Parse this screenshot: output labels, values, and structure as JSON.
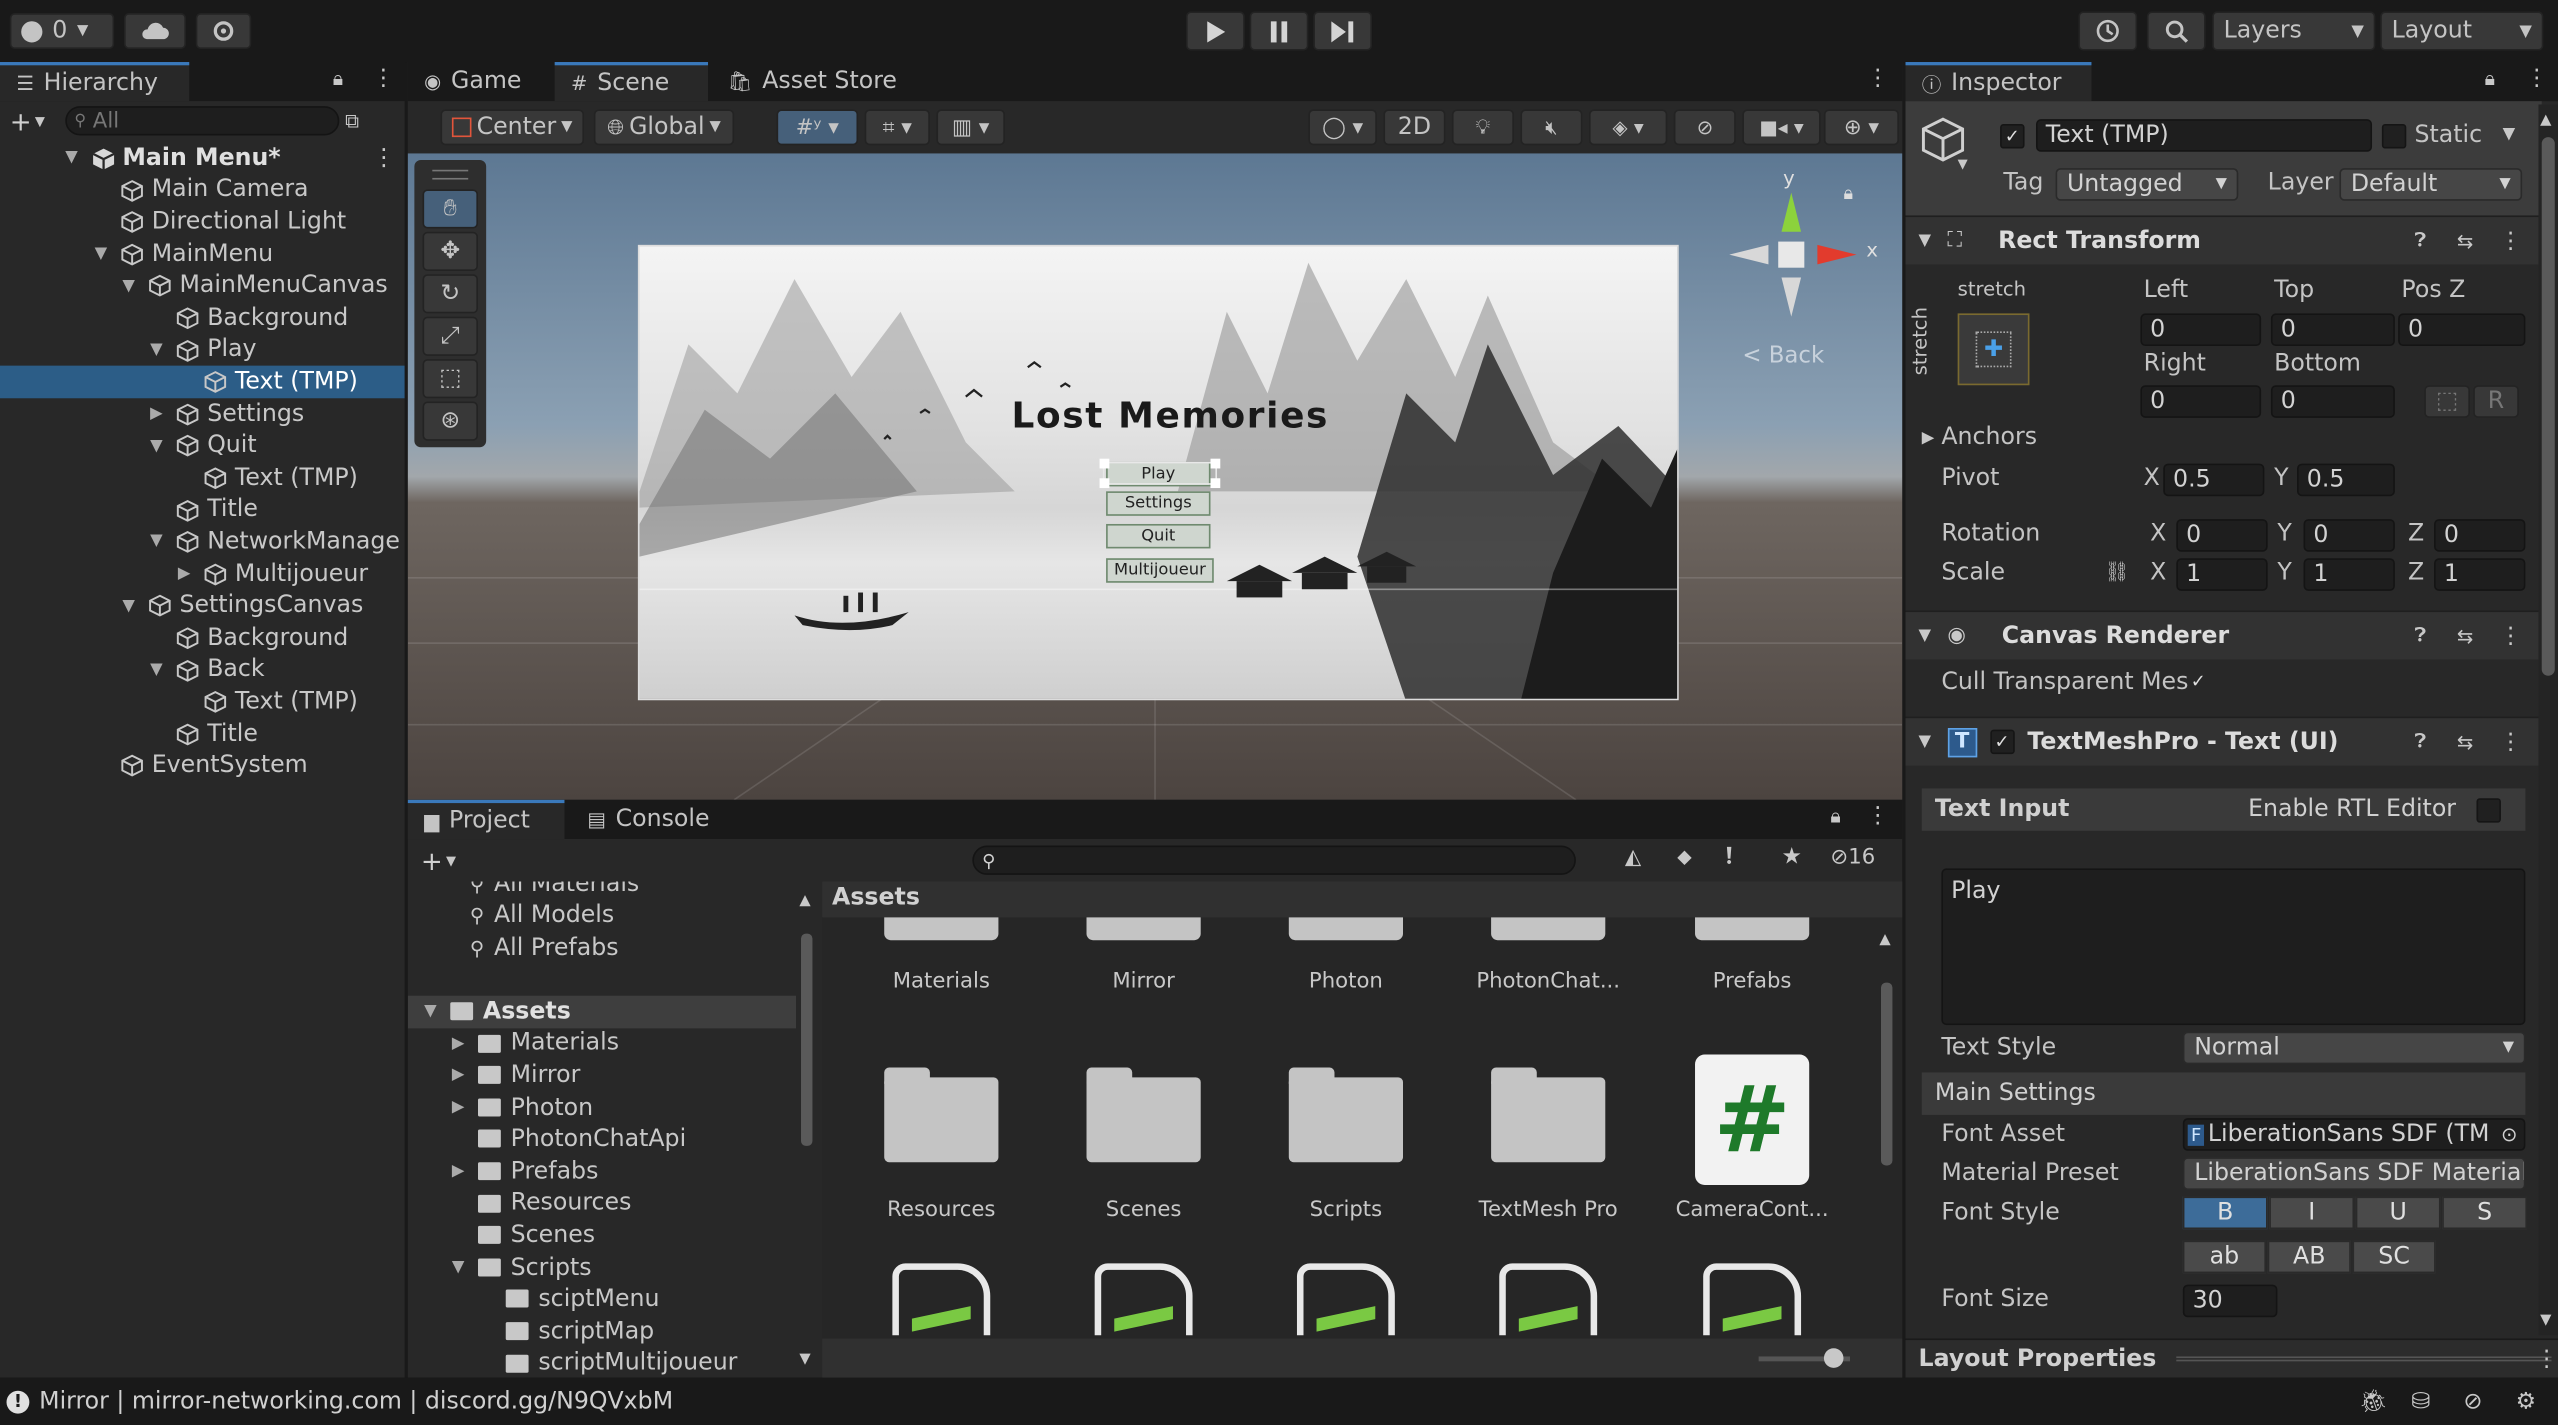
{
  "toolbar": {
    "account_count": "0",
    "layers_label": "Layers",
    "layout_label": "Layout"
  },
  "hierarchy": {
    "tab_label": "Hierarchy",
    "search_placeholder": "All",
    "items": [
      {
        "label": "Main Menu*",
        "depth": 0,
        "expanded": true,
        "root": true
      },
      {
        "label": "Main Camera",
        "depth": 1
      },
      {
        "label": "Directional Light",
        "depth": 1
      },
      {
        "label": "MainMenu",
        "depth": 1,
        "expanded": true
      },
      {
        "label": "MainMenuCanvas",
        "depth": 2,
        "expanded": true
      },
      {
        "label": "Background",
        "depth": 3
      },
      {
        "label": "Play",
        "depth": 3,
        "expanded": true
      },
      {
        "label": "Text (TMP)",
        "depth": 4,
        "selected": true
      },
      {
        "label": "Settings",
        "depth": 3,
        "collapsed": true
      },
      {
        "label": "Quit",
        "depth": 3,
        "expanded": true
      },
      {
        "label": "Text (TMP)",
        "depth": 4
      },
      {
        "label": "Title",
        "depth": 3
      },
      {
        "label": "NetworkManage",
        "depth": 3,
        "expanded": true
      },
      {
        "label": "Multijoueur",
        "depth": 4,
        "collapsed": true
      },
      {
        "label": "SettingsCanvas",
        "depth": 2,
        "expanded": true
      },
      {
        "label": "Background",
        "depth": 3
      },
      {
        "label": "Back",
        "depth": 3,
        "expanded": true
      },
      {
        "label": "Text (TMP)",
        "depth": 4
      },
      {
        "label": "Title",
        "depth": 3
      },
      {
        "label": "EventSystem",
        "depth": 1
      }
    ]
  },
  "scene": {
    "tabs": [
      "Game",
      "Scene",
      "Asset Store"
    ],
    "active_tab": "Scene",
    "pivot_mode": "Center",
    "pivot_rotation": "Global",
    "mode_2d": "2D",
    "gizmo_y": "y",
    "gizmo_x": "x",
    "back_label": "< Back",
    "canvas_title": "Lost Memories",
    "menu_buttons": [
      "Play",
      "Settings",
      "Quit",
      "Multijoueur"
    ]
  },
  "project": {
    "tabs": [
      "Project",
      "Console"
    ],
    "hidden_count": "16",
    "favorites": [
      "All Materials",
      "All Models",
      "All Prefabs"
    ],
    "tree": [
      {
        "label": "Assets",
        "depth": 0,
        "expanded": true,
        "selected": true
      },
      {
        "label": "Materials",
        "depth": 1,
        "collapsed": true
      },
      {
        "label": "Mirror",
        "depth": 1,
        "collapsed": true
      },
      {
        "label": "Photon",
        "depth": 1,
        "collapsed": true
      },
      {
        "label": "PhotonChatApi",
        "depth": 1
      },
      {
        "label": "Prefabs",
        "depth": 1,
        "collapsed": true
      },
      {
        "label": "Resources",
        "depth": 1
      },
      {
        "label": "Scenes",
        "depth": 1
      },
      {
        "label": "Scripts",
        "depth": 1,
        "expanded": true
      },
      {
        "label": "sciptMenu",
        "depth": 2
      },
      {
        "label": "scriptMap",
        "depth": 2
      },
      {
        "label": "scriptMultijoueur",
        "depth": 2
      }
    ],
    "breadcrumb": "Assets",
    "assets_row1": [
      "Materials",
      "Mirror",
      "Photon",
      "PhotonChat...",
      "Prefabs"
    ],
    "assets_row2": [
      "Resources",
      "Scenes",
      "Scripts",
      "TextMesh Pro",
      "CameraCont..."
    ],
    "script_glyph": "#"
  },
  "inspector": {
    "tab_label": "Inspector",
    "object_name": "Text (TMP)",
    "static_label": "Static",
    "tag_label": "Tag",
    "tag_value": "Untagged",
    "layer_label": "Layer",
    "layer_value": "Default",
    "rect_transform": {
      "title": "Rect Transform",
      "anchor_h": "stretch",
      "anchor_v": "stretch",
      "left_label": "Left",
      "left": "0",
      "top_label": "Top",
      "top": "0",
      "posz_label": "Pos Z",
      "posz": "0",
      "right_label": "Right",
      "right": "0",
      "bottom_label": "Bottom",
      "bottom": "0",
      "r_button": "R",
      "anchors_label": "Anchors",
      "pivot_label": "Pivot",
      "pivot_x": "0.5",
      "pivot_y": "0.5",
      "rotation_label": "Rotation",
      "rot_x": "0",
      "rot_y": "0",
      "rot_z": "0",
      "scale_label": "Scale",
      "scale_x": "1",
      "scale_y": "1",
      "scale_z": "1",
      "axis_x": "X",
      "axis_y": "Y",
      "axis_z": "Z"
    },
    "canvas_renderer": {
      "title": "Canvas Renderer",
      "cull_label": "Cull Transparent Mes"
    },
    "textmeshpro": {
      "title": "TextMeshPro - Text (UI)",
      "icon_letter": "T",
      "text_input_label": "Text Input",
      "rtl_label": "Enable RTL Editor",
      "text_value": "Play",
      "text_style_label": "Text Style",
      "text_style_value": "Normal",
      "main_settings_label": "Main Settings",
      "font_asset_label": "Font Asset",
      "font_asset_value": "LiberationSans SDF (TM",
      "font_asset_icon": "F",
      "material_label": "Material Preset",
      "material_value": "LiberationSans SDF Material",
      "font_style_label": "Font Style",
      "style_buttons_row1": [
        "B",
        "I",
        "U",
        "S"
      ],
      "style_buttons_row2": [
        "ab",
        "AB",
        "SC"
      ],
      "font_size_label": "Font Size",
      "font_size_value": "30"
    },
    "layout_properties": "Layout Properties"
  },
  "status_bar": {
    "message": "Mirror | mirror-networking.com | discord.gg/N9QVxbM"
  }
}
